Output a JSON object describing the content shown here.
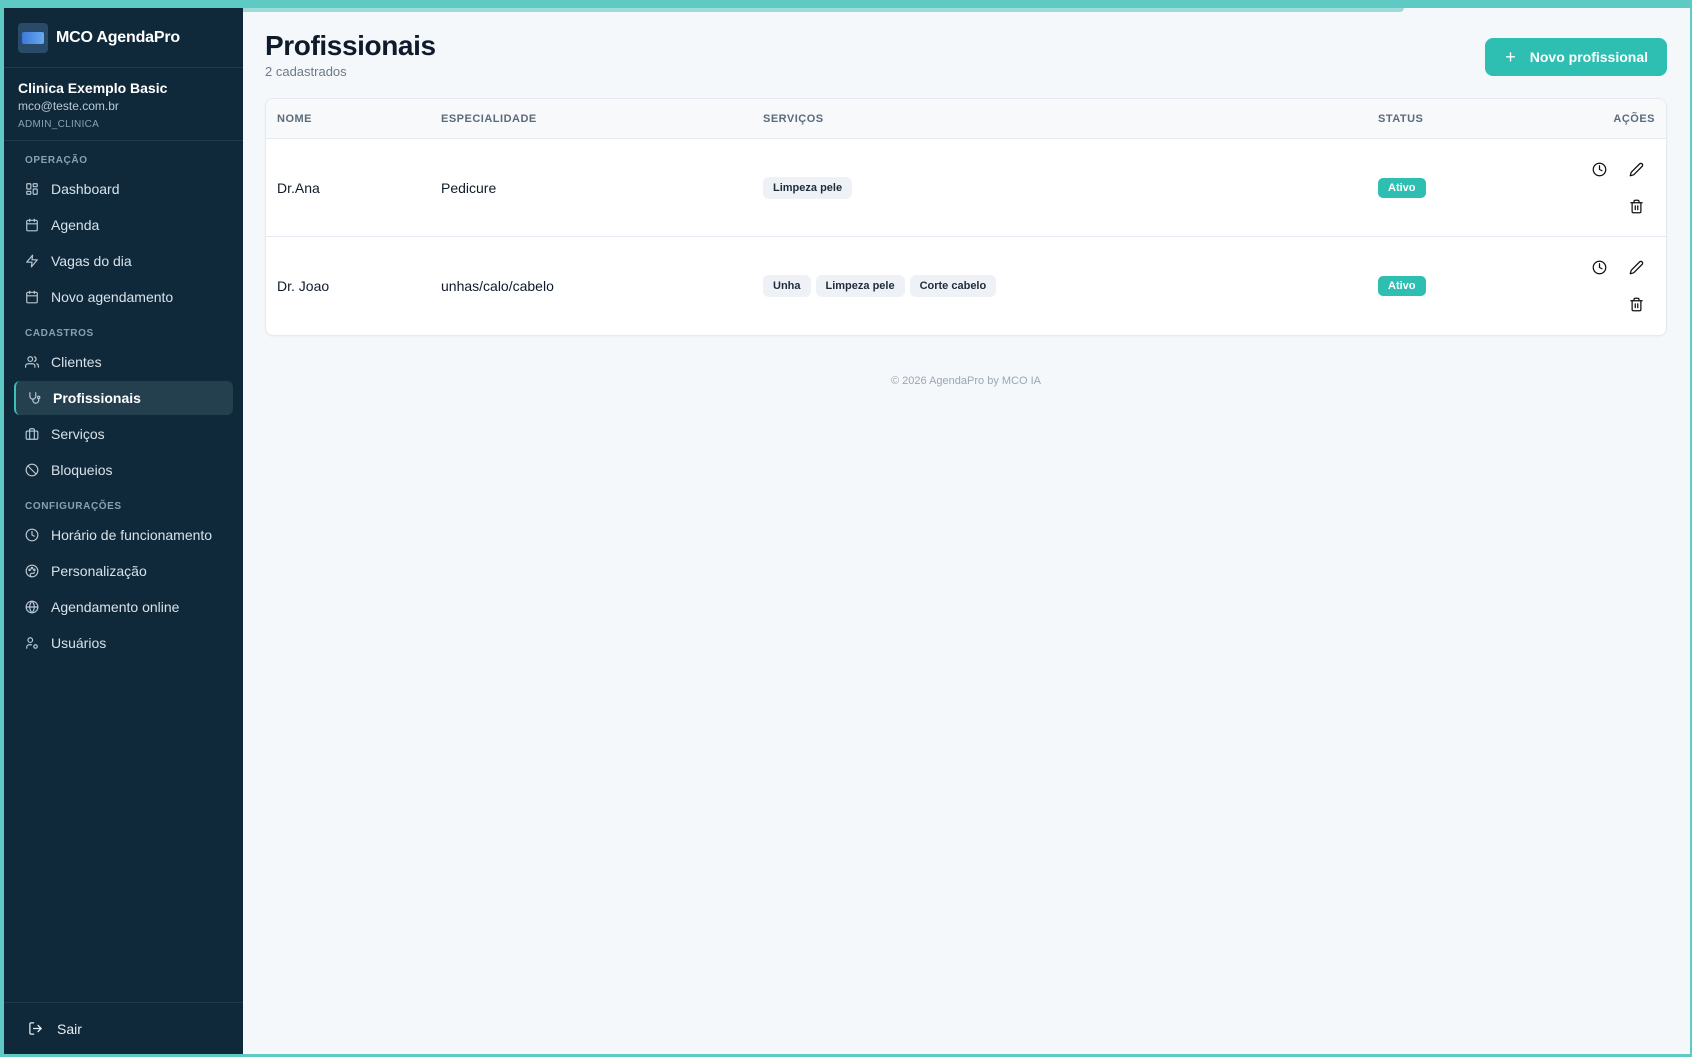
{
  "brand": {
    "name": "MCO AgendaPro"
  },
  "account": {
    "name": "Clinica Exemplo Basic",
    "email": "mco@teste.com.br",
    "role": "ADMIN_CLINICA"
  },
  "sidebar": {
    "sections": [
      {
        "label": "OPERAÇÃO",
        "items": [
          {
            "label": "Dashboard",
            "icon": "dashboard-icon"
          },
          {
            "label": "Agenda",
            "icon": "calendar-icon"
          },
          {
            "label": "Vagas do dia",
            "icon": "bolt-icon"
          },
          {
            "label": "Novo agendamento",
            "icon": "calendar-plus-icon"
          }
        ]
      },
      {
        "label": "CADASTROS",
        "items": [
          {
            "label": "Clientes",
            "icon": "users-icon"
          },
          {
            "label": "Profissionais",
            "icon": "stethoscope-icon",
            "active": true
          },
          {
            "label": "Serviços",
            "icon": "briefcase-icon"
          },
          {
            "label": "Bloqueios",
            "icon": "ban-icon"
          }
        ]
      },
      {
        "label": "CONFIGURAÇÕES",
        "items": [
          {
            "label": "Horário de funcionamento",
            "icon": "clock-icon"
          },
          {
            "label": "Personalização",
            "icon": "palette-icon"
          },
          {
            "label": "Agendamento online",
            "icon": "globe-icon"
          },
          {
            "label": "Usuários",
            "icon": "user-cog-icon"
          }
        ]
      }
    ],
    "logout_label": "Sair"
  },
  "page": {
    "title": "Profissionais",
    "subtitle": "2 cadastrados",
    "new_button_label": "Novo profissional"
  },
  "table": {
    "headers": {
      "name": "NOME",
      "specialty": "ESPECIALIDADE",
      "services": "SERVIÇOS",
      "status": "STATUS",
      "actions": "AÇÕES"
    },
    "rows": [
      {
        "name": "Dr.Ana",
        "specialty": "Pedicure",
        "services": [
          "Limpeza pele"
        ],
        "status": "Ativo"
      },
      {
        "name": "Dr. Joao",
        "specialty": "unhas/calo/cabelo",
        "services": [
          "Unha",
          "Limpeza pele",
          "Corte cabelo"
        ],
        "status": "Ativo"
      }
    ]
  },
  "footer": {
    "text": "© 2026 AgendaPro by MCO IA"
  },
  "colors": {
    "accent": "#2ebfb2",
    "sidebar_bg": "#10293a",
    "page_bg": "#f5f8fb"
  }
}
